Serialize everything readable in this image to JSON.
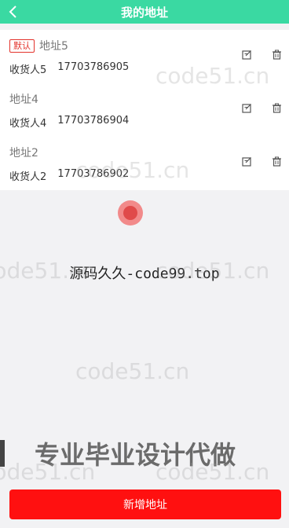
{
  "header": {
    "title": "我的地址",
    "back_icon": "chevron-left-icon",
    "background": "#3ad9a2"
  },
  "addresses": [
    {
      "is_default": true,
      "default_badge": "默认",
      "title": "地址5",
      "recipient": "收货人5",
      "phone": "17703786905"
    },
    {
      "is_default": false,
      "default_badge": "",
      "title": "地址4",
      "recipient": "收货人4",
      "phone": "17703786904"
    },
    {
      "is_default": false,
      "default_badge": "",
      "title": "地址2",
      "recipient": "收货人2",
      "phone": "17703786902"
    }
  ],
  "item_actions": {
    "edit_icon": "edit-icon",
    "delete_icon": "trash-icon"
  },
  "overlay": {
    "center_text": "源码久久-code99.top",
    "banner_text": "专业毕业设计代做",
    "watermark_text": "code51.cn"
  },
  "footer": {
    "add_button_label": "新增地址",
    "add_button_color": "#ff1010"
  }
}
